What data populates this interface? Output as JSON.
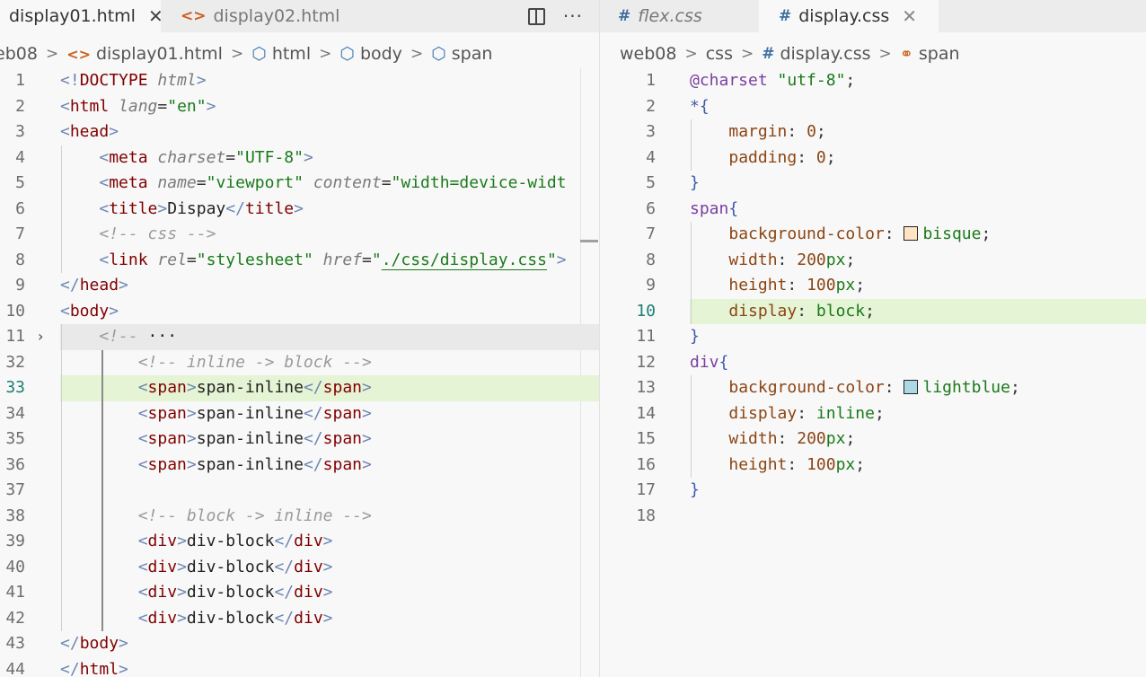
{
  "left": {
    "tabs": [
      {
        "label": "display01.html",
        "icon": "<>",
        "active": true,
        "close": "✕"
      },
      {
        "label": "display02.html",
        "icon": "<>",
        "active": false
      }
    ],
    "actions": {
      "more": "···"
    },
    "breadcrumb": [
      {
        "label": "eb08",
        "icon": ""
      },
      {
        "label": "display01.html",
        "icon": "<>"
      },
      {
        "label": "html",
        "icon": "⬡"
      },
      {
        "label": "body",
        "icon": "⬡"
      },
      {
        "label": "span",
        "icon": "⬡"
      }
    ],
    "lines": [
      {
        "n": "1",
        "indent": 0,
        "tokens": [
          {
            "t": "br",
            "v": "<!"
          },
          {
            "t": "tag",
            "v": "DOCTYPE"
          },
          {
            "t": "text",
            "v": " "
          },
          {
            "t": "attr",
            "v": "html"
          },
          {
            "t": "br",
            "v": ">"
          }
        ]
      },
      {
        "n": "2",
        "indent": 0,
        "tokens": [
          {
            "t": "br",
            "v": "<"
          },
          {
            "t": "tag",
            "v": "html"
          },
          {
            "t": "text",
            "v": " "
          },
          {
            "t": "attr",
            "v": "lang"
          },
          {
            "t": "eq",
            "v": "="
          },
          {
            "t": "str",
            "v": "\"en\""
          },
          {
            "t": "br",
            "v": ">"
          }
        ]
      },
      {
        "n": "3",
        "indent": 0,
        "tokens": [
          {
            "t": "br",
            "v": "<"
          },
          {
            "t": "tag",
            "v": "head"
          },
          {
            "t": "br",
            "v": ">"
          }
        ]
      },
      {
        "n": "4",
        "indent": 1,
        "tokens": [
          {
            "t": "br",
            "v": "<"
          },
          {
            "t": "tag",
            "v": "meta"
          },
          {
            "t": "text",
            "v": " "
          },
          {
            "t": "attr",
            "v": "charset"
          },
          {
            "t": "eq",
            "v": "="
          },
          {
            "t": "str",
            "v": "\"UTF-8\""
          },
          {
            "t": "br",
            "v": ">"
          }
        ]
      },
      {
        "n": "5",
        "indent": 1,
        "tokens": [
          {
            "t": "br",
            "v": "<"
          },
          {
            "t": "tag",
            "v": "meta"
          },
          {
            "t": "text",
            "v": " "
          },
          {
            "t": "attr",
            "v": "name"
          },
          {
            "t": "eq",
            "v": "="
          },
          {
            "t": "str",
            "v": "\"viewport\""
          },
          {
            "t": "text",
            "v": " "
          },
          {
            "t": "attr",
            "v": "content"
          },
          {
            "t": "eq",
            "v": "="
          },
          {
            "t": "str",
            "v": "\"width=device-widt"
          }
        ]
      },
      {
        "n": "6",
        "indent": 1,
        "tokens": [
          {
            "t": "br",
            "v": "<"
          },
          {
            "t": "tag",
            "v": "title"
          },
          {
            "t": "br",
            "v": ">"
          },
          {
            "t": "text",
            "v": "Dispay"
          },
          {
            "t": "br",
            "v": "</"
          },
          {
            "t": "tag",
            "v": "title"
          },
          {
            "t": "br",
            "v": ">"
          }
        ]
      },
      {
        "n": "7",
        "indent": 1,
        "tokens": [
          {
            "t": "com",
            "v": "<!-- css -->"
          }
        ]
      },
      {
        "n": "8",
        "indent": 1,
        "tokens": [
          {
            "t": "br",
            "v": "<"
          },
          {
            "t": "tag",
            "v": "link"
          },
          {
            "t": "text",
            "v": " "
          },
          {
            "t": "attr",
            "v": "rel"
          },
          {
            "t": "eq",
            "v": "="
          },
          {
            "t": "str",
            "v": "\"stylesheet\""
          },
          {
            "t": "text",
            "v": " "
          },
          {
            "t": "attr",
            "v": "href"
          },
          {
            "t": "eq",
            "v": "="
          },
          {
            "t": "str",
            "v": "\""
          },
          {
            "t": "strlink",
            "v": "./css/display.css"
          },
          {
            "t": "str",
            "v": "\""
          },
          {
            "t": "br",
            "v": ">"
          }
        ]
      },
      {
        "n": "9",
        "indent": 0,
        "tokens": [
          {
            "t": "br",
            "v": "</"
          },
          {
            "t": "tag",
            "v": "head"
          },
          {
            "t": "br",
            "v": ">"
          }
        ]
      },
      {
        "n": "10",
        "indent": 0,
        "tokens": [
          {
            "t": "br",
            "v": "<"
          },
          {
            "t": "tag",
            "v": "body"
          },
          {
            "t": "br",
            "v": ">"
          }
        ]
      },
      {
        "n": "11",
        "indent": 1,
        "folded": true,
        "tokens": [
          {
            "t": "com",
            "v": "<!-- "
          },
          {
            "t": "text",
            "v": "···"
          }
        ]
      },
      {
        "n": "32",
        "indent": 2,
        "tokens": [
          {
            "t": "com",
            "v": "<!-- inline -> block -->"
          }
        ]
      },
      {
        "n": "33",
        "indent": 2,
        "current": true,
        "tokens": [
          {
            "t": "br",
            "v": "<"
          },
          {
            "t": "tag",
            "v": "span"
          },
          {
            "t": "br",
            "v": ">"
          },
          {
            "t": "text",
            "v": "span-inline"
          },
          {
            "t": "br",
            "v": "</"
          },
          {
            "t": "tag",
            "v": "span"
          },
          {
            "t": "br",
            "v": ">"
          }
        ]
      },
      {
        "n": "34",
        "indent": 2,
        "tokens": [
          {
            "t": "br",
            "v": "<"
          },
          {
            "t": "tag",
            "v": "span"
          },
          {
            "t": "br",
            "v": ">"
          },
          {
            "t": "text",
            "v": "span-inline"
          },
          {
            "t": "br",
            "v": "</"
          },
          {
            "t": "tag",
            "v": "span"
          },
          {
            "t": "br",
            "v": ">"
          }
        ]
      },
      {
        "n": "35",
        "indent": 2,
        "tokens": [
          {
            "t": "br",
            "v": "<"
          },
          {
            "t": "tag",
            "v": "span"
          },
          {
            "t": "br",
            "v": ">"
          },
          {
            "t": "text",
            "v": "span-inline"
          },
          {
            "t": "br",
            "v": "</"
          },
          {
            "t": "tag",
            "v": "span"
          },
          {
            "t": "br",
            "v": ">"
          }
        ]
      },
      {
        "n": "36",
        "indent": 2,
        "tokens": [
          {
            "t": "br",
            "v": "<"
          },
          {
            "t": "tag",
            "v": "span"
          },
          {
            "t": "br",
            "v": ">"
          },
          {
            "t": "text",
            "v": "span-inline"
          },
          {
            "t": "br",
            "v": "</"
          },
          {
            "t": "tag",
            "v": "span"
          },
          {
            "t": "br",
            "v": ">"
          }
        ]
      },
      {
        "n": "37",
        "indent": 2,
        "tokens": []
      },
      {
        "n": "38",
        "indent": 2,
        "tokens": [
          {
            "t": "com",
            "v": "<!-- block -> inline -->"
          }
        ]
      },
      {
        "n": "39",
        "indent": 2,
        "tokens": [
          {
            "t": "br",
            "v": "<"
          },
          {
            "t": "tag",
            "v": "div"
          },
          {
            "t": "br",
            "v": ">"
          },
          {
            "t": "text",
            "v": "div-block"
          },
          {
            "t": "br",
            "v": "</"
          },
          {
            "t": "tag",
            "v": "div"
          },
          {
            "t": "br",
            "v": ">"
          }
        ]
      },
      {
        "n": "40",
        "indent": 2,
        "tokens": [
          {
            "t": "br",
            "v": "<"
          },
          {
            "t": "tag",
            "v": "div"
          },
          {
            "t": "br",
            "v": ">"
          },
          {
            "t": "text",
            "v": "div-block"
          },
          {
            "t": "br",
            "v": "</"
          },
          {
            "t": "tag",
            "v": "div"
          },
          {
            "t": "br",
            "v": ">"
          }
        ]
      },
      {
        "n": "41",
        "indent": 2,
        "tokens": [
          {
            "t": "br",
            "v": "<"
          },
          {
            "t": "tag",
            "v": "div"
          },
          {
            "t": "br",
            "v": ">"
          },
          {
            "t": "text",
            "v": "div-block"
          },
          {
            "t": "br",
            "v": "</"
          },
          {
            "t": "tag",
            "v": "div"
          },
          {
            "t": "br",
            "v": ">"
          }
        ]
      },
      {
        "n": "42",
        "indent": 2,
        "tokens": [
          {
            "t": "br",
            "v": "<"
          },
          {
            "t": "tag",
            "v": "div"
          },
          {
            "t": "br",
            "v": ">"
          },
          {
            "t": "text",
            "v": "div-block"
          },
          {
            "t": "br",
            "v": "</"
          },
          {
            "t": "tag",
            "v": "div"
          },
          {
            "t": "br",
            "v": ">"
          }
        ]
      },
      {
        "n": "43",
        "indent": 0,
        "tokens": [
          {
            "t": "br",
            "v": "</"
          },
          {
            "t": "tag",
            "v": "body"
          },
          {
            "t": "br",
            "v": ">"
          }
        ]
      },
      {
        "n": "44",
        "indent": 0,
        "tokens": [
          {
            "t": "br",
            "v": "</"
          },
          {
            "t": "tag",
            "v": "html"
          },
          {
            "t": "br",
            "v": ">"
          }
        ]
      }
    ]
  },
  "right": {
    "tabs": [
      {
        "label": "flex.css",
        "icon": "#",
        "active": false
      },
      {
        "label": "display.css",
        "icon": "#",
        "active": true,
        "close": "✕"
      }
    ],
    "breadcrumb": [
      {
        "label": "web08",
        "icon": ""
      },
      {
        "label": "css",
        "icon": ""
      },
      {
        "label": "display.css",
        "icon": "#"
      },
      {
        "label": "span",
        "icon": "⚭"
      }
    ],
    "lines": [
      {
        "n": "1",
        "indent": 0,
        "tokens": [
          {
            "t": "at",
            "v": "@charset"
          },
          {
            "t": "text",
            "v": " "
          },
          {
            "t": "str",
            "v": "\"utf-8\""
          },
          {
            "t": "punc",
            "v": ";"
          }
        ]
      },
      {
        "n": "2",
        "indent": 0,
        "tokens": [
          {
            "t": "brace",
            "v": "*{"
          }
        ]
      },
      {
        "n": "3",
        "indent": 1,
        "tokens": [
          {
            "t": "prop",
            "v": "margin"
          },
          {
            "t": "punc",
            "v": ": "
          },
          {
            "t": "num",
            "v": "0"
          },
          {
            "t": "punc",
            "v": ";"
          }
        ]
      },
      {
        "n": "4",
        "indent": 1,
        "tokens": [
          {
            "t": "prop",
            "v": "padding"
          },
          {
            "t": "punc",
            "v": ": "
          },
          {
            "t": "num",
            "v": "0"
          },
          {
            "t": "punc",
            "v": ";"
          }
        ]
      },
      {
        "n": "5",
        "indent": 0,
        "tokens": [
          {
            "t": "brace",
            "v": "}"
          }
        ]
      },
      {
        "n": "6",
        "indent": 0,
        "tokens": [
          {
            "t": "sel",
            "v": "span"
          },
          {
            "t": "brace",
            "v": "{"
          }
        ]
      },
      {
        "n": "7",
        "indent": 1,
        "tokens": [
          {
            "t": "prop",
            "v": "background-color"
          },
          {
            "t": "punc",
            "v": ": "
          },
          {
            "t": "swatch",
            "v": "#ffe4c4"
          },
          {
            "t": "val",
            "v": "bisque"
          },
          {
            "t": "punc",
            "v": ";"
          }
        ]
      },
      {
        "n": "8",
        "indent": 1,
        "tokens": [
          {
            "t": "prop",
            "v": "width"
          },
          {
            "t": "punc",
            "v": ": "
          },
          {
            "t": "num",
            "v": "200"
          },
          {
            "t": "unit",
            "v": "px"
          },
          {
            "t": "punc",
            "v": ";"
          }
        ]
      },
      {
        "n": "9",
        "indent": 1,
        "tokens": [
          {
            "t": "prop",
            "v": "height"
          },
          {
            "t": "punc",
            "v": ": "
          },
          {
            "t": "num",
            "v": "100"
          },
          {
            "t": "unit",
            "v": "px"
          },
          {
            "t": "punc",
            "v": ";"
          }
        ]
      },
      {
        "n": "10",
        "indent": 1,
        "current": true,
        "tokens": [
          {
            "t": "prop",
            "v": "display"
          },
          {
            "t": "punc",
            "v": ": "
          },
          {
            "t": "val",
            "v": "block"
          },
          {
            "t": "punc",
            "v": ";"
          }
        ]
      },
      {
        "n": "11",
        "indent": 0,
        "tokens": [
          {
            "t": "brace",
            "v": "}"
          }
        ]
      },
      {
        "n": "12",
        "indent": 0,
        "tokens": [
          {
            "t": "sel",
            "v": "div"
          },
          {
            "t": "brace",
            "v": "{"
          }
        ]
      },
      {
        "n": "13",
        "indent": 1,
        "tokens": [
          {
            "t": "prop",
            "v": "background-color"
          },
          {
            "t": "punc",
            "v": ": "
          },
          {
            "t": "swatch",
            "v": "#add8e6"
          },
          {
            "t": "val",
            "v": "lightblue"
          },
          {
            "t": "punc",
            "v": ";"
          }
        ]
      },
      {
        "n": "14",
        "indent": 1,
        "tokens": [
          {
            "t": "prop",
            "v": "display"
          },
          {
            "t": "punc",
            "v": ": "
          },
          {
            "t": "val",
            "v": "inline"
          },
          {
            "t": "punc",
            "v": ";"
          }
        ]
      },
      {
        "n": "15",
        "indent": 1,
        "tokens": [
          {
            "t": "prop",
            "v": "width"
          },
          {
            "t": "punc",
            "v": ": "
          },
          {
            "t": "num",
            "v": "200"
          },
          {
            "t": "unit",
            "v": "px"
          },
          {
            "t": "punc",
            "v": ";"
          }
        ]
      },
      {
        "n": "16",
        "indent": 1,
        "tokens": [
          {
            "t": "prop",
            "v": "height"
          },
          {
            "t": "punc",
            "v": ": "
          },
          {
            "t": "num",
            "v": "100"
          },
          {
            "t": "unit",
            "v": "px"
          },
          {
            "t": "punc",
            "v": ";"
          }
        ]
      },
      {
        "n": "17",
        "indent": 0,
        "tokens": [
          {
            "t": "brace",
            "v": "}"
          }
        ]
      },
      {
        "n": "18",
        "indent": 0,
        "tokens": []
      }
    ]
  }
}
